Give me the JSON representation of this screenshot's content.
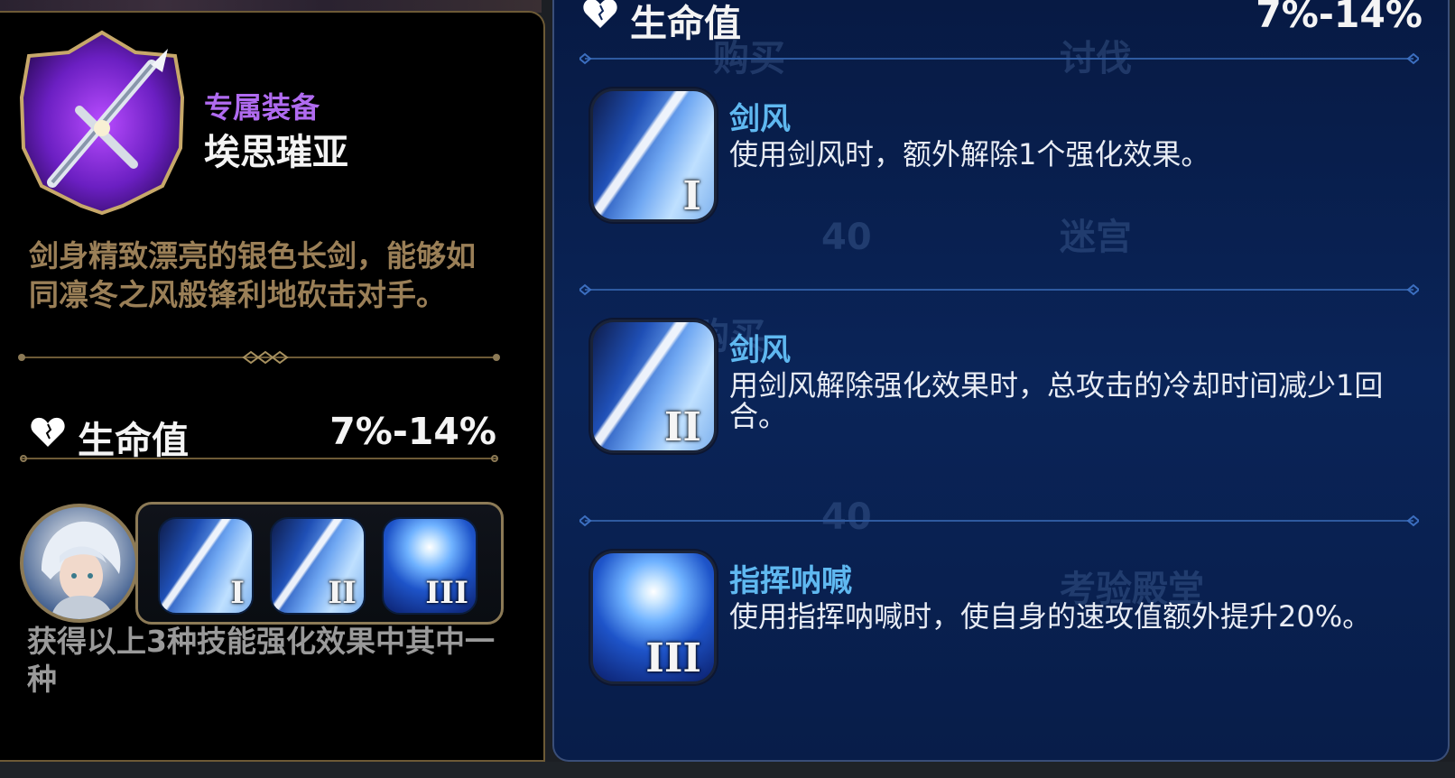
{
  "gear": {
    "category": "专属装备",
    "name": "埃思璀亚",
    "description": "剑身精致漂亮的银色长剑，能够如同凛冬之风般锋利地砍击对手。",
    "stat": {
      "label": "生命值",
      "value": "7%-14%"
    },
    "tray_caption": "获得以上3种技能强化效果中其中一种",
    "tray_skills": [
      {
        "roman": "I",
        "art": "sword"
      },
      {
        "roman": "II",
        "art": "sword"
      },
      {
        "roman": "III",
        "art": "snow"
      }
    ]
  },
  "detail": {
    "stat": {
      "label": "生命值",
      "value": "7%-14%"
    },
    "skills": [
      {
        "name": "剑风",
        "roman": "I",
        "desc": "使用剑风时，额外解除1个强化效果。",
        "art": "sword"
      },
      {
        "name": "剑风",
        "roman": "II",
        "desc": "用剑风解除强化效果时，总攻击的冷却时间减少1回合。",
        "art": "sword"
      },
      {
        "name": "指挥呐喊",
        "roman": "III",
        "desc": "使用指挥呐喊时，使自身的速攻值额外提升20%。",
        "art": "snow"
      }
    ]
  },
  "background": {
    "labels": [
      "购买",
      "讨伐",
      "40",
      "迷宫",
      "购买",
      "40",
      "考验殿堂"
    ]
  },
  "colors": {
    "gold_border": "#8c7a56",
    "category_purple": "#b06bf0",
    "desc_gold": "#9a7f57",
    "skill_name_blue": "#5fb8f0",
    "panel_blue": "#0a2458"
  }
}
